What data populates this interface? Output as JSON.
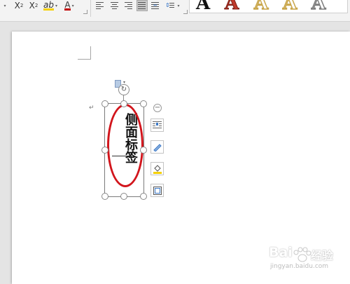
{
  "ribbon": {
    "font_group": {
      "superscript": {
        "base": "X",
        "mark": "2"
      },
      "subscript": {
        "base": "X",
        "mark": "2"
      },
      "highlight_label": "ab",
      "font_color_label": "A",
      "highlight_color": "#f5d000",
      "font_color": "#c00000"
    },
    "paragraph_group": {
      "active_alignment": "justify"
    },
    "text_effects_gallery": [
      {
        "letter": "A",
        "fill": "#111111",
        "stroke": "#111111"
      },
      {
        "letter": "A",
        "fill": "#c0392b",
        "stroke": "#7b1e15"
      },
      {
        "letter": "A",
        "fill": "#ffffff",
        "stroke": "#c9a64b"
      },
      {
        "letter": "A",
        "fill": "#ffffff",
        "stroke": "#c9a64b"
      },
      {
        "letter": "A",
        "fill": "#ffffff",
        "stroke": "#7d7d7d"
      }
    ]
  },
  "document": {
    "paragraph_mark": "↵",
    "textbox": {
      "text": "侧面标签",
      "highlight_color": "#d2151c"
    },
    "layout_tools": [
      {
        "name": "layout-options",
        "icon": "wrap-text-icon"
      },
      {
        "name": "shape-outline",
        "icon": "pen-icon"
      },
      {
        "name": "shape-fill",
        "icon": "fill-bucket-icon"
      },
      {
        "name": "shape-effects",
        "icon": "frame-icon"
      }
    ]
  },
  "watermark": {
    "logo": "Bai",
    "logo_suffix": "经验",
    "url": "jingyan.baidu.com"
  }
}
